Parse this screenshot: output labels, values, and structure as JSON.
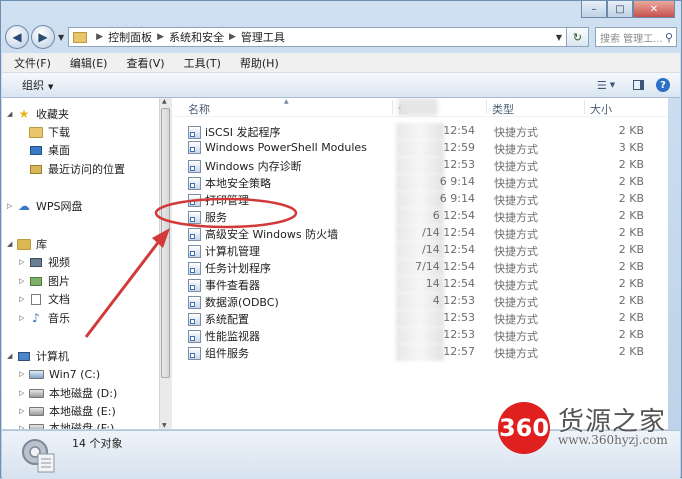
{
  "window": {
    "caption": {
      "minimize": "–",
      "maximize": "□",
      "close": "✕"
    }
  },
  "nav": {
    "back": "◀",
    "forward": "▶",
    "breadcrumb": [
      "控制面板",
      "系统和安全",
      "管理工具"
    ],
    "search_placeholder": "搜索 管理工...",
    "refresh": "↻"
  },
  "menu": [
    "文件(F)",
    "编辑(E)",
    "查看(V)",
    "工具(T)",
    "帮助(H)"
  ],
  "toolbar": {
    "organize": "组织",
    "help": "?"
  },
  "tree": {
    "favorites": "收藏夹",
    "downloads": "下载",
    "desktop": "桌面",
    "recent": "最近访问的位置",
    "wps": "WPS网盘",
    "library": "库",
    "videos": "视频",
    "pictures": "图片",
    "documents": "文档",
    "music": "音乐",
    "computer": "计算机",
    "drive_c": "Win7 (C:)",
    "drive_d": "本地磁盘 (D:)",
    "drive_e": "本地磁盘 (E:)",
    "drive_f": "本地磁盘 (F:)"
  },
  "columns": {
    "name": "名称",
    "date": "修",
    "type": "类型",
    "size": "大小"
  },
  "files": [
    {
      "name": "iSCSI 发起程序",
      "date": "12:54",
      "type": "快捷方式",
      "size": "2 KB"
    },
    {
      "name": "Windows PowerShell Modules",
      "date": "12:59",
      "type": "快捷方式",
      "size": "3 KB"
    },
    {
      "name": "Windows 内存诊断",
      "date": "12:53",
      "type": "快捷方式",
      "size": "2 KB"
    },
    {
      "name": "本地安全策略",
      "date": "6 9:14",
      "type": "快捷方式",
      "size": "2 KB"
    },
    {
      "name": "打印管理",
      "date": "6 9:14",
      "type": "快捷方式",
      "size": "2 KB"
    },
    {
      "name": "服务",
      "date": "6 12:54",
      "type": "快捷方式",
      "size": "2 KB"
    },
    {
      "name": "高级安全 Windows 防火墙",
      "date": "/14 12:54",
      "type": "快捷方式",
      "size": "2 KB"
    },
    {
      "name": "计算机管理",
      "date": "/14 12:54",
      "type": "快捷方式",
      "size": "2 KB"
    },
    {
      "name": "任务计划程序",
      "date": "7/14 12:54",
      "type": "快捷方式",
      "size": "2 KB"
    },
    {
      "name": "事件查看器",
      "date": "14 12:54",
      "type": "快捷方式",
      "size": "2 KB"
    },
    {
      "name": "数据源(ODBC)",
      "date": "4 12:53",
      "type": "快捷方式",
      "size": "2 KB"
    },
    {
      "name": "系统配置",
      "date": "12:53",
      "type": "快捷方式",
      "size": "2 KB"
    },
    {
      "name": "性能监视器",
      "date": "12:53",
      "type": "快捷方式",
      "size": "2 KB"
    },
    {
      "name": "组件服务",
      "date": "12:57",
      "type": "快捷方式",
      "size": "2 KB"
    }
  ],
  "status": {
    "count": "14 个对象"
  },
  "watermark": {
    "badge": "360",
    "name": "货源之家",
    "url": "www.360hyzj.com"
  },
  "colors": {
    "annotation_red": "#d23a3a",
    "window_frame": "#6f8fb2"
  }
}
